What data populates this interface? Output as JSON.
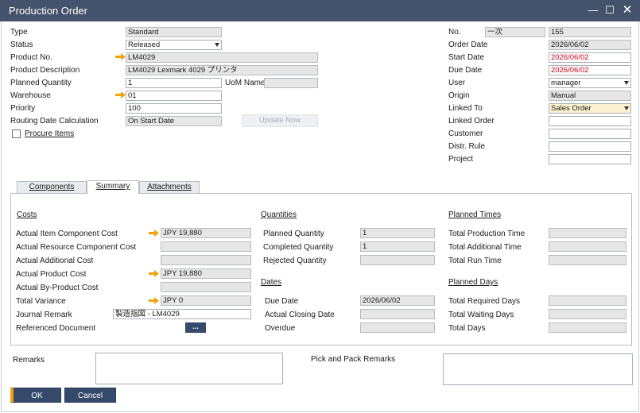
{
  "window": {
    "title": "Production Order"
  },
  "header_left": {
    "type": {
      "label": "Type",
      "value": "Standard"
    },
    "status": {
      "label": "Status",
      "value": "Released"
    },
    "product_no": {
      "label": "Product No.",
      "value": "LM4029"
    },
    "product_description": {
      "label": "Product Description",
      "value": "LM4029 Lexmark 4029 プリンタ"
    },
    "planned_quantity": {
      "label": "Planned Quantity",
      "value": "1"
    },
    "uom_name": {
      "label": "UoM Name",
      "value": ""
    },
    "warehouse": {
      "label": "Warehouse",
      "value": "01"
    },
    "priority": {
      "label": "Priority",
      "value": "100"
    },
    "routing_date_calc": {
      "label": "Routing Date Calculation",
      "value": "On Start Date"
    },
    "update_now": "Update Now",
    "procure_items": {
      "label": "Procure Items",
      "checked": false
    }
  },
  "header_right": {
    "no": {
      "label": "No.",
      "series": "一次",
      "value": "155"
    },
    "order_date": {
      "label": "Order Date",
      "value": "2026/06/02"
    },
    "start_date": {
      "label": "Start Date",
      "value": "2026/06/02"
    },
    "due_date": {
      "label": "Due Date",
      "value": "2026/06/02"
    },
    "user": {
      "label": "User",
      "value": "manager"
    },
    "origin": {
      "label": "Origin",
      "value": "Manual"
    },
    "linked_to": {
      "label": "Linked To",
      "value": "Sales Order"
    },
    "linked_order": {
      "label": "Linked Order",
      "value": ""
    },
    "customer": {
      "label": "Customer",
      "value": ""
    },
    "distr_rule": {
      "label": "Distr. Rule",
      "value": ""
    },
    "project": {
      "label": "Project",
      "value": ""
    }
  },
  "tabs": [
    {
      "label": "Components",
      "active": false
    },
    {
      "label": "Summary",
      "active": true
    },
    {
      "label": "Attachments",
      "active": false
    }
  ],
  "costs": {
    "heading": "Costs",
    "actual_item_component_cost": {
      "label": "Actual Item Component Cost",
      "value": "JPY 19,880"
    },
    "actual_resource_component_cost": {
      "label": "Actual Resource Component Cost",
      "value": ""
    },
    "actual_additional_cost": {
      "label": "Actual Additional Cost",
      "value": ""
    },
    "actual_product_cost": {
      "label": "Actual Product Cost",
      "value": "JPY 19,880"
    },
    "actual_byproduct_cost": {
      "label": "Actual By-Product Cost",
      "value": ""
    },
    "total_variance": {
      "label": "Total Variance",
      "value": "JPY 0"
    },
    "journal_remark": {
      "label": "Journal Remark",
      "value": "製造指図 - LM4029"
    },
    "referenced_document": {
      "label": "Referenced Document",
      "button": "..."
    }
  },
  "quantities": {
    "heading": "Quantities",
    "planned_quantity": {
      "label": "Planned Quantity",
      "value": "1"
    },
    "completed_quantity": {
      "label": "Completed Quantity",
      "value": "1"
    },
    "rejected_quantity": {
      "label": "Rejected Quantity",
      "value": ""
    }
  },
  "dates": {
    "heading": "Dates",
    "due_date": {
      "label": "Due Date",
      "value": "2026/06/02"
    },
    "actual_closing_date": {
      "label": "Actual Closing Date",
      "value": ""
    },
    "overdue": {
      "label": "Overdue",
      "value": ""
    }
  },
  "planned_times": {
    "heading": "Planned Times",
    "total_production_time": {
      "label": "Total Production Time",
      "value": ""
    },
    "total_additional_time": {
      "label": "Total Additional Time",
      "value": ""
    },
    "total_run_time": {
      "label": "Total Run Time",
      "value": ""
    }
  },
  "planned_days": {
    "heading": "Planned Days",
    "total_required_days": {
      "label": "Total Required Days",
      "value": ""
    },
    "total_waiting_days": {
      "label": "Total Waiting Days",
      "value": ""
    },
    "total_days": {
      "label": "Total Days",
      "value": ""
    }
  },
  "footer": {
    "remarks_label": "Remarks",
    "pick_pack_label": "Pick and Pack Remarks",
    "ok": "OK",
    "cancel": "Cancel"
  },
  "colors": {
    "titlebar": "#44536b",
    "primary_button": "#354a6b",
    "accent": "#f0a30a",
    "date_red": "#d0021b",
    "link_arrow": "#f0a30a"
  }
}
